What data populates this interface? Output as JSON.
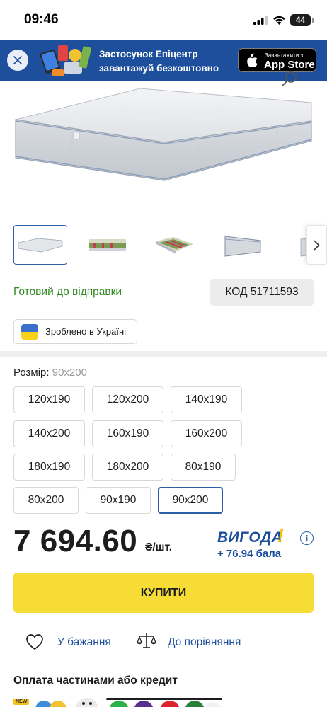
{
  "status_bar": {
    "time": "09:46",
    "battery": "44"
  },
  "banner": {
    "line1": "Застосунок Епіцентр",
    "line2": "завантажуй безкоштовно",
    "store_small": "Завантажити з",
    "store_big": "App Store"
  },
  "product": {
    "availability": "Готовий до відправки",
    "code": "КОД 51711593",
    "made_in": "Зроблено в Україні"
  },
  "size": {
    "label": "Розмір:",
    "selected_value": "90x200",
    "options": [
      "120x190",
      "120x200",
      "140x190",
      "140x200",
      "160x190",
      "160x200",
      "180x190",
      "180x200",
      "80x190",
      "80x200",
      "90x190",
      "90x200"
    ]
  },
  "price": {
    "value": "7 694.60",
    "unit": "₴/шт.",
    "benefit": "ВИГОДА",
    "bonus": "+ 76.94 бала"
  },
  "actions": {
    "buy": "КУПИТИ",
    "wishlist": "У бажання",
    "compare": "До порівняння"
  },
  "credit": {
    "title": "Оплата частинами або кредит",
    "badge": "NEW"
  },
  "colors": {
    "brand_blue": "#1e4f9c",
    "buy_yellow": "#f6dc35",
    "ready_green": "#2e8b1f"
  }
}
